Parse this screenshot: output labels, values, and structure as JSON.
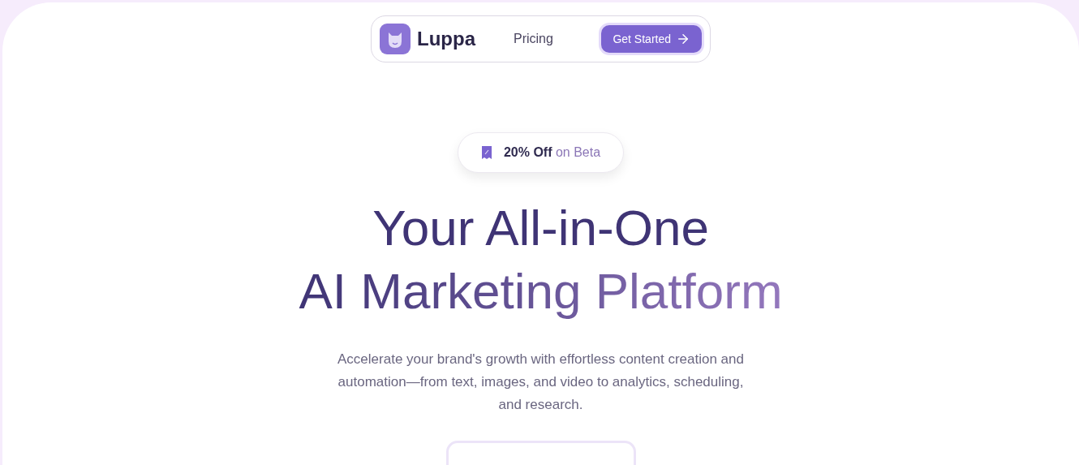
{
  "nav": {
    "brand": "Luppa",
    "links": [
      {
        "label": "Pricing"
      }
    ],
    "cta": {
      "label": "Get Started"
    }
  },
  "badge": {
    "highlight": "20% Off",
    "text": "on Beta"
  },
  "headline": {
    "line_1": "Your All-in-One",
    "line_2": "AI Marketing Platform"
  },
  "subtitle": "Accelerate your brand's growth with effortless content creation and automation—from text, images, and video to analytics, scheduling, and research."
}
